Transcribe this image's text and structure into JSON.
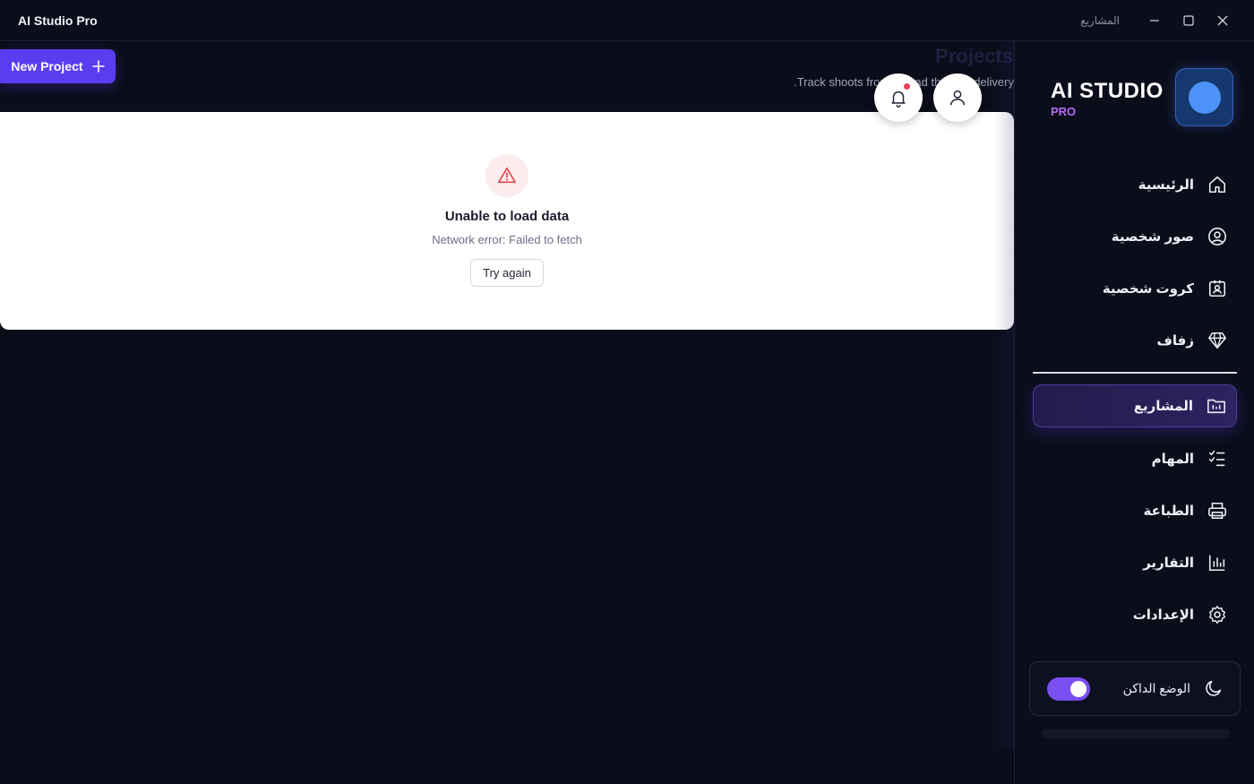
{
  "titlebar": {
    "app_title": "AI Studio Pro",
    "window_label": "المشاريع",
    "minimize_icon": "minimize-icon",
    "maximize_icon": "maximize-icon",
    "close_icon": "close-icon"
  },
  "toolbar": {
    "new_project_label": "New Project",
    "new_project_icon": "plus-icon"
  },
  "header": {
    "title": "Projects",
    "subtitle": ".Track shoots from upload through delivery",
    "bell_icon": "bell-icon",
    "user_icon": "user-icon"
  },
  "error": {
    "icon": "warning-triangle-icon",
    "title": "Unable to load data",
    "message": "Network error: Failed to fetch",
    "retry_label": "Try again"
  },
  "sidebar": {
    "brand_name": "AI STUDIO",
    "brand_sub": "PRO",
    "items": [
      {
        "label": "الرئيسية",
        "icon": "home-icon"
      },
      {
        "label": "صور شخصية",
        "icon": "user-circle-icon"
      },
      {
        "label": "كروت شخصية",
        "icon": "id-card-icon"
      },
      {
        "label": "زفاف",
        "icon": "diamond-icon"
      },
      {
        "label": "المشاريع",
        "icon": "folder-chart-icon",
        "active": true
      },
      {
        "label": "المهام",
        "icon": "task-list-icon"
      },
      {
        "label": "الطباعة",
        "icon": "printer-icon"
      },
      {
        "label": "التقارير",
        "icon": "bar-chart-icon"
      },
      {
        "label": "الإعدادات",
        "icon": "gear-icon"
      }
    ],
    "theme": {
      "label": "الوضع الداكن",
      "icon": "moon-icon",
      "enabled": true
    }
  },
  "colors": {
    "background": "#0b0d1a",
    "accent": "#5b3df0",
    "brand_sub": "#b66cf7",
    "notification": "#ef3f5c",
    "error_icon": "#e0484e"
  }
}
